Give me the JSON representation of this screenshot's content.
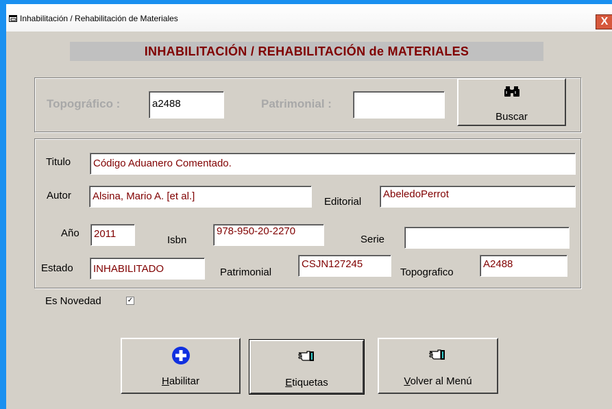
{
  "window": {
    "title": "Inhabilitación / Rehabilitación de Materiales",
    "close_glyph": "X"
  },
  "header": {
    "banner": "INHABILITACIÓN / REHABILITACIÓN de MATERIALES"
  },
  "search": {
    "topografico_label": "Topográfico :",
    "topografico_value": "a2488",
    "patrimonial_label": "Patrimonial :",
    "patrimonial_value": "",
    "buscar_label": "Buscar",
    "buscar_icon": "binoculars-icon"
  },
  "details": {
    "titulo_label": "Titulo",
    "titulo_value": "Código Aduanero Comentado.",
    "autor_label": "Autor",
    "autor_value": "Alsina, Mario A. [et  al.]",
    "editorial_label": "Editorial",
    "editorial_value": "AbeledoPerrot",
    "anio_label": "Año",
    "anio_value": "2011",
    "isbn_label": "Isbn",
    "isbn_value": "978-950-20-2270",
    "serie_label": "Serie",
    "serie_value": "",
    "estado_label": "Estado",
    "estado_value": "INHABILITADO",
    "patrimonial_label": "Patrimonial",
    "patrimonial_value": "CSJN127245",
    "topografico_label": "Topografico",
    "topografico_value": "A2488"
  },
  "novedad": {
    "label": "Es Novedad",
    "checked": true,
    "check_glyph": "✓"
  },
  "actions": {
    "habilitar": {
      "mnemonic": "H",
      "rest": "abilitar",
      "icon": "plus-circle-icon"
    },
    "etiquetas": {
      "mnemonic": "E",
      "rest": "tiquetas",
      "icon": "pointing-hand-icon"
    },
    "volver": {
      "mnemonic": "V",
      "rest": "olver al Menú",
      "icon": "pointing-hand-icon"
    }
  },
  "colors": {
    "accent": "#800000",
    "desktop": "#1a90f0",
    "face": "#d4d0c8",
    "close": "#d6583c"
  }
}
